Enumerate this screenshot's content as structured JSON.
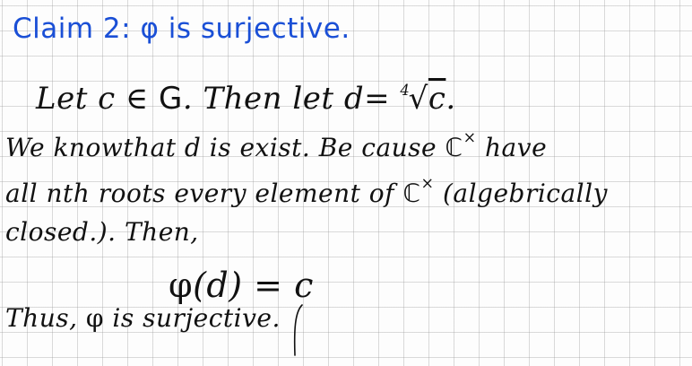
{
  "claim_line": {
    "prefix": "Claim 2: ",
    "phi": "φ",
    "text": " is surjective."
  },
  "line1": {
    "let": "Let c ∈ ",
    "G": "G",
    "then": ". Then let d= ",
    "index": "4",
    "radicand": "c",
    "end": "."
  },
  "line2": {
    "text": "We knowthat d is exist. Be cause ",
    "C": "ℂ",
    "sup": "×",
    "tail": " have"
  },
  "line3": {
    "text": "all nth roots every element of ",
    "C": "ℂ",
    "sup": "×",
    "tail": " (algebrically"
  },
  "line4": {
    "text": "closed.). Then,"
  },
  "line5": {
    "phi": "φ",
    "text": "(d) = c"
  },
  "line6": {
    "start": "Thus, ",
    "phi": "φ",
    "mid": " is ",
    "end": "surjective."
  },
  "colors": {
    "claim_ink": "#1a4fd6",
    "ink": "#111111",
    "grid": "#969696"
  }
}
